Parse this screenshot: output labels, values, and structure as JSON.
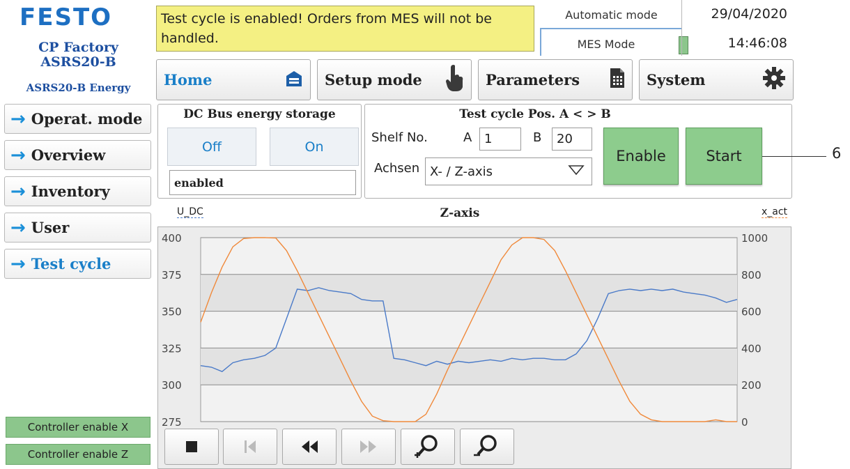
{
  "brand": {
    "logo": "FESTO",
    "line1": "CP Factory",
    "line2": "ASRS20-B",
    "line3": "ASRS20-B Energy"
  },
  "nav": {
    "items": [
      {
        "label": "Operat. mode"
      },
      {
        "label": "Overview"
      },
      {
        "label": "Inventory"
      },
      {
        "label": "User"
      },
      {
        "label": "Test cycle"
      }
    ],
    "controller_x": "Controller enable X",
    "controller_z": "Controller enable Z"
  },
  "header": {
    "message": "Test cycle is enabled! Orders from MES will not be handled.",
    "auto_mode": "Automatic mode",
    "mes_mode": "MES Mode",
    "date": "29/04/2020",
    "time": "14:46:08"
  },
  "tabs": {
    "home": "Home",
    "setup": "Setup mode",
    "parameters": "Parameters",
    "system": "System"
  },
  "energy": {
    "title": "DC Bus energy storage",
    "off": "Off",
    "on": "On",
    "status": "enabled"
  },
  "testcycle": {
    "title": "Test cycle Pos. A < > B",
    "shelf_label": "Shelf No.",
    "a_label": "A",
    "a_value": "1",
    "b_label": "B",
    "b_value": "20",
    "axes_label": "Achsen",
    "axes_value": "X- / Z-axis",
    "enable": "Enable",
    "start": "Start"
  },
  "callout": "6",
  "chart_data": {
    "type": "line",
    "title": "Z-axis",
    "ylabel_left": "U_DC",
    "ylabel_right": "x_act",
    "left_axis": {
      "ticks": [
        "400",
        "375",
        "350",
        "325",
        "300",
        "275"
      ],
      "range": [
        275,
        400
      ]
    },
    "right_axis": {
      "ticks": [
        "1000",
        "800",
        "600",
        "400",
        "200",
        "0"
      ],
      "range": [
        0,
        1000
      ]
    },
    "series": [
      {
        "name": "U_DC",
        "axis": "left",
        "color": "#4a7ac8",
        "x": [
          0,
          0.02,
          0.04,
          0.06,
          0.08,
          0.1,
          0.12,
          0.14,
          0.16,
          0.18,
          0.2,
          0.22,
          0.24,
          0.26,
          0.28,
          0.3,
          0.32,
          0.34,
          0.36,
          0.38,
          0.4,
          0.42,
          0.44,
          0.46,
          0.48,
          0.5,
          0.52,
          0.54,
          0.56,
          0.58,
          0.6,
          0.62,
          0.64,
          0.66,
          0.68,
          0.7,
          0.72,
          0.74,
          0.76,
          0.78,
          0.8,
          0.82,
          0.84,
          0.86,
          0.88,
          0.9,
          0.92,
          0.94,
          0.96,
          0.98,
          1.0
        ],
        "values": [
          313,
          312,
          309,
          315,
          317,
          318,
          320,
          325,
          345,
          365,
          364,
          366,
          364,
          363,
          362,
          358,
          357,
          357,
          318,
          317,
          315,
          313,
          316,
          314,
          316,
          315,
          316,
          317,
          316,
          318,
          317,
          318,
          318,
          317,
          317,
          321,
          330,
          345,
          362,
          364,
          365,
          364,
          365,
          364,
          365,
          363,
          362,
          361,
          359,
          356,
          358
        ]
      },
      {
        "name": "x_act",
        "axis": "right",
        "color": "#f0893a",
        "x": [
          0,
          0.02,
          0.04,
          0.06,
          0.08,
          0.1,
          0.12,
          0.14,
          0.16,
          0.18,
          0.2,
          0.22,
          0.24,
          0.26,
          0.28,
          0.3,
          0.32,
          0.34,
          0.36,
          0.38,
          0.4,
          0.42,
          0.44,
          0.46,
          0.48,
          0.5,
          0.52,
          0.54,
          0.56,
          0.58,
          0.6,
          0.62,
          0.64,
          0.66,
          0.68,
          0.7,
          0.72,
          0.74,
          0.76,
          0.78,
          0.8,
          0.82,
          0.84,
          0.86,
          0.88,
          0.9,
          0.92,
          0.94,
          0.96,
          0.98,
          1.0
        ],
        "values": [
          540,
          700,
          840,
          950,
          995,
          1000,
          1000,
          998,
          930,
          820,
          700,
          580,
          460,
          340,
          220,
          110,
          30,
          5,
          0,
          0,
          0,
          40,
          150,
          280,
          400,
          520,
          640,
          760,
          880,
          960,
          1000,
          1000,
          990,
          930,
          820,
          700,
          580,
          460,
          340,
          220,
          110,
          40,
          10,
          0,
          0,
          0,
          0,
          0,
          10,
          0,
          0
        ]
      }
    ],
    "grid": true
  },
  "toolbar": {
    "buttons": [
      "stop-icon",
      "skip-start-icon",
      "rewind-icon",
      "forward-icon",
      "zoom-in-icon",
      "zoom-out-icon"
    ]
  }
}
